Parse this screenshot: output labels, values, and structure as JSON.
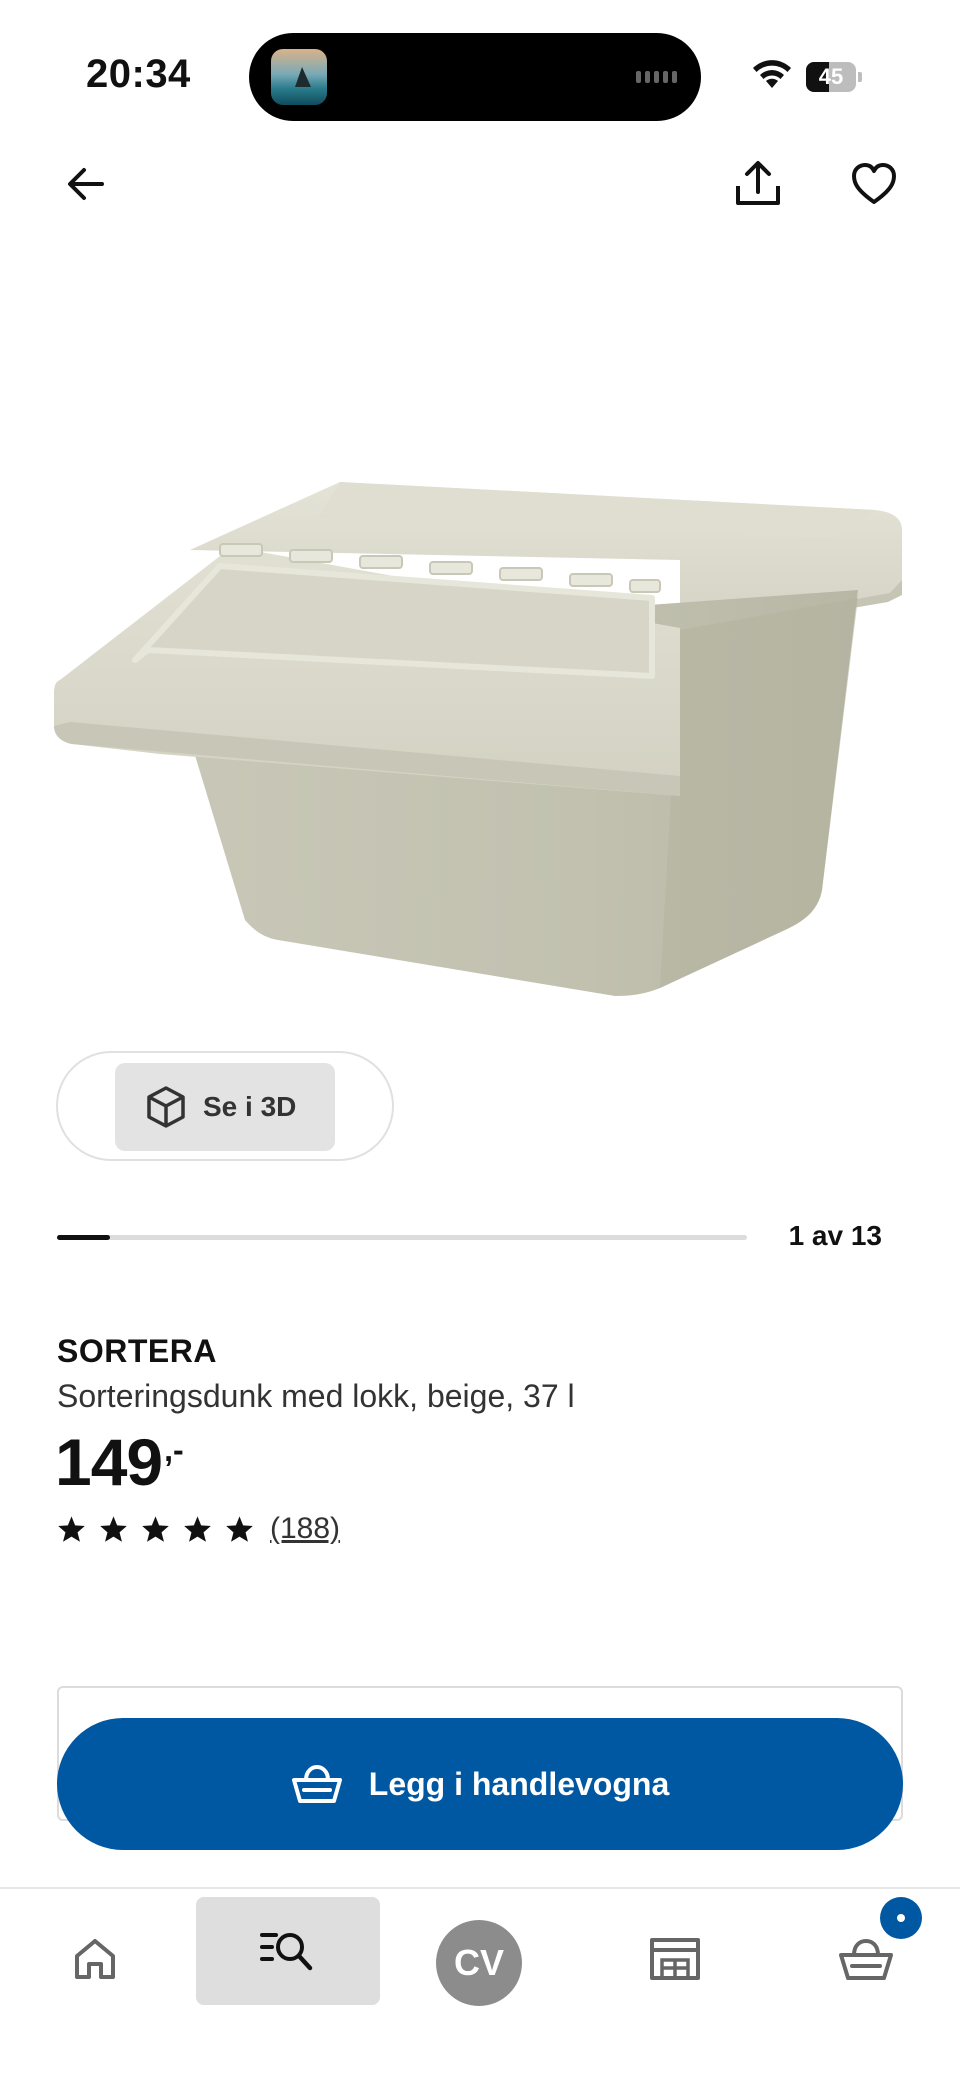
{
  "status_bar": {
    "time": "20:34",
    "battery_level": "45",
    "battery_fraction": 0.45,
    "wifi_icon": "wifi-icon"
  },
  "top_nav": {
    "back_icon": "arrow-left-icon",
    "share_icon": "share-icon",
    "favorite_icon": "heart-icon"
  },
  "gallery": {
    "view_3d_label": "Se i 3D",
    "view_3d_icon": "cube-icon",
    "position_label": "1 av 13",
    "current_image": 1,
    "total_images": 13
  },
  "product": {
    "brand": "SORTERA",
    "description": "Sorteringsdunk med lokk, beige, 37 l",
    "price_integer": "149",
    "price_suffix": ",-",
    "rating_stars": 5,
    "rating_max": 5,
    "review_count": "(188)"
  },
  "actions": {
    "add_to_cart_label": "Legg i handlevogna",
    "add_to_cart_icon": "basket-icon"
  },
  "tab_bar": {
    "home_icon": "home-icon",
    "search_icon": "search-list-icon",
    "profile_initials": "CV",
    "store_icon": "store-icon",
    "cart_icon": "basket-icon"
  },
  "colors": {
    "primary_blue": "#0058a3",
    "product_beige": "#cfcec0"
  }
}
